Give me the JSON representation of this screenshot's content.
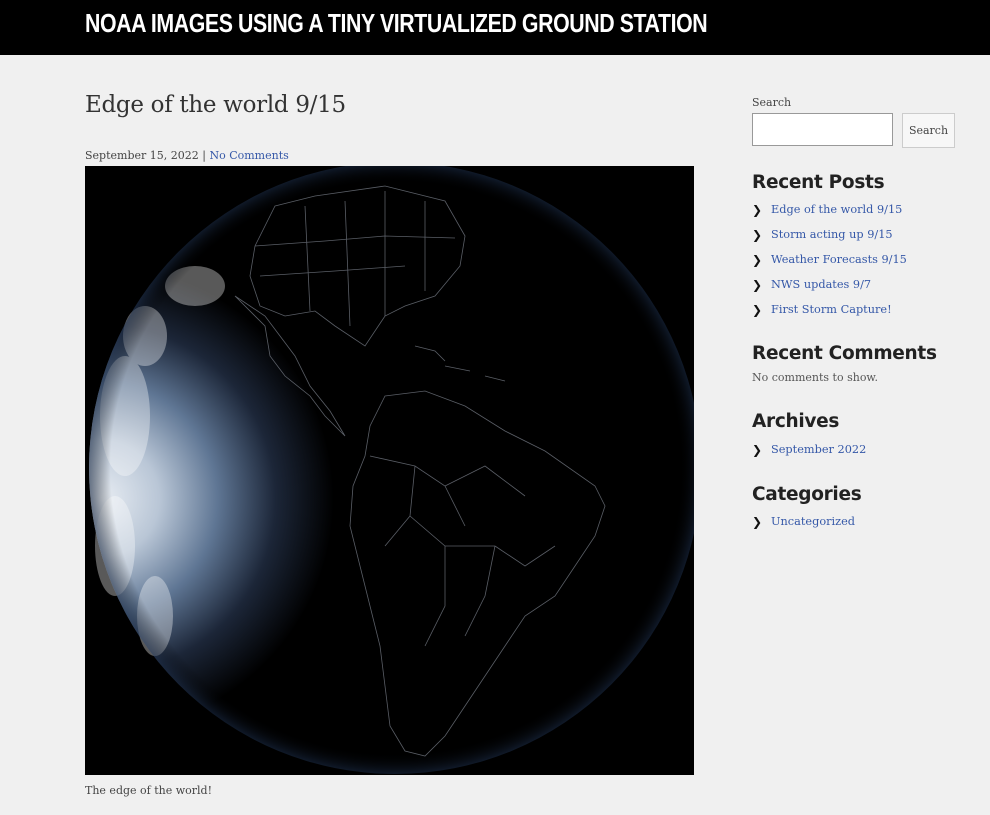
{
  "header": {
    "site_title": "NOAA Images using a tiny virtualized ground station"
  },
  "post": {
    "title": "Edge of the world 9/15",
    "date": "September 15, 2022",
    "separator": "|",
    "comments_link": "No Comments",
    "caption": "The edge of the world!",
    "image_alt": "Satellite image of the Americas at the edge of daylight"
  },
  "sidebar": {
    "search": {
      "label": "Search",
      "button": "Search",
      "value": ""
    },
    "recent_posts": {
      "title": "Recent Posts",
      "items": [
        "Edge of the world 9/15",
        "Storm acting up 9/15",
        "Weather Forecasts 9/15",
        "NWS updates 9/7",
        "First Storm Capture!"
      ]
    },
    "recent_comments": {
      "title": "Recent Comments",
      "empty_text": "No comments to show."
    },
    "archives": {
      "title": "Archives",
      "items": [
        "September 2022"
      ]
    },
    "categories": {
      "title": "Categories",
      "items": [
        "Uncategorized"
      ]
    }
  },
  "colors": {
    "header_bg": "#000000",
    "page_bg": "#f0f0f0",
    "link": "#3558a8"
  },
  "icons": {
    "list_bullet": "chevron-right-icon"
  }
}
